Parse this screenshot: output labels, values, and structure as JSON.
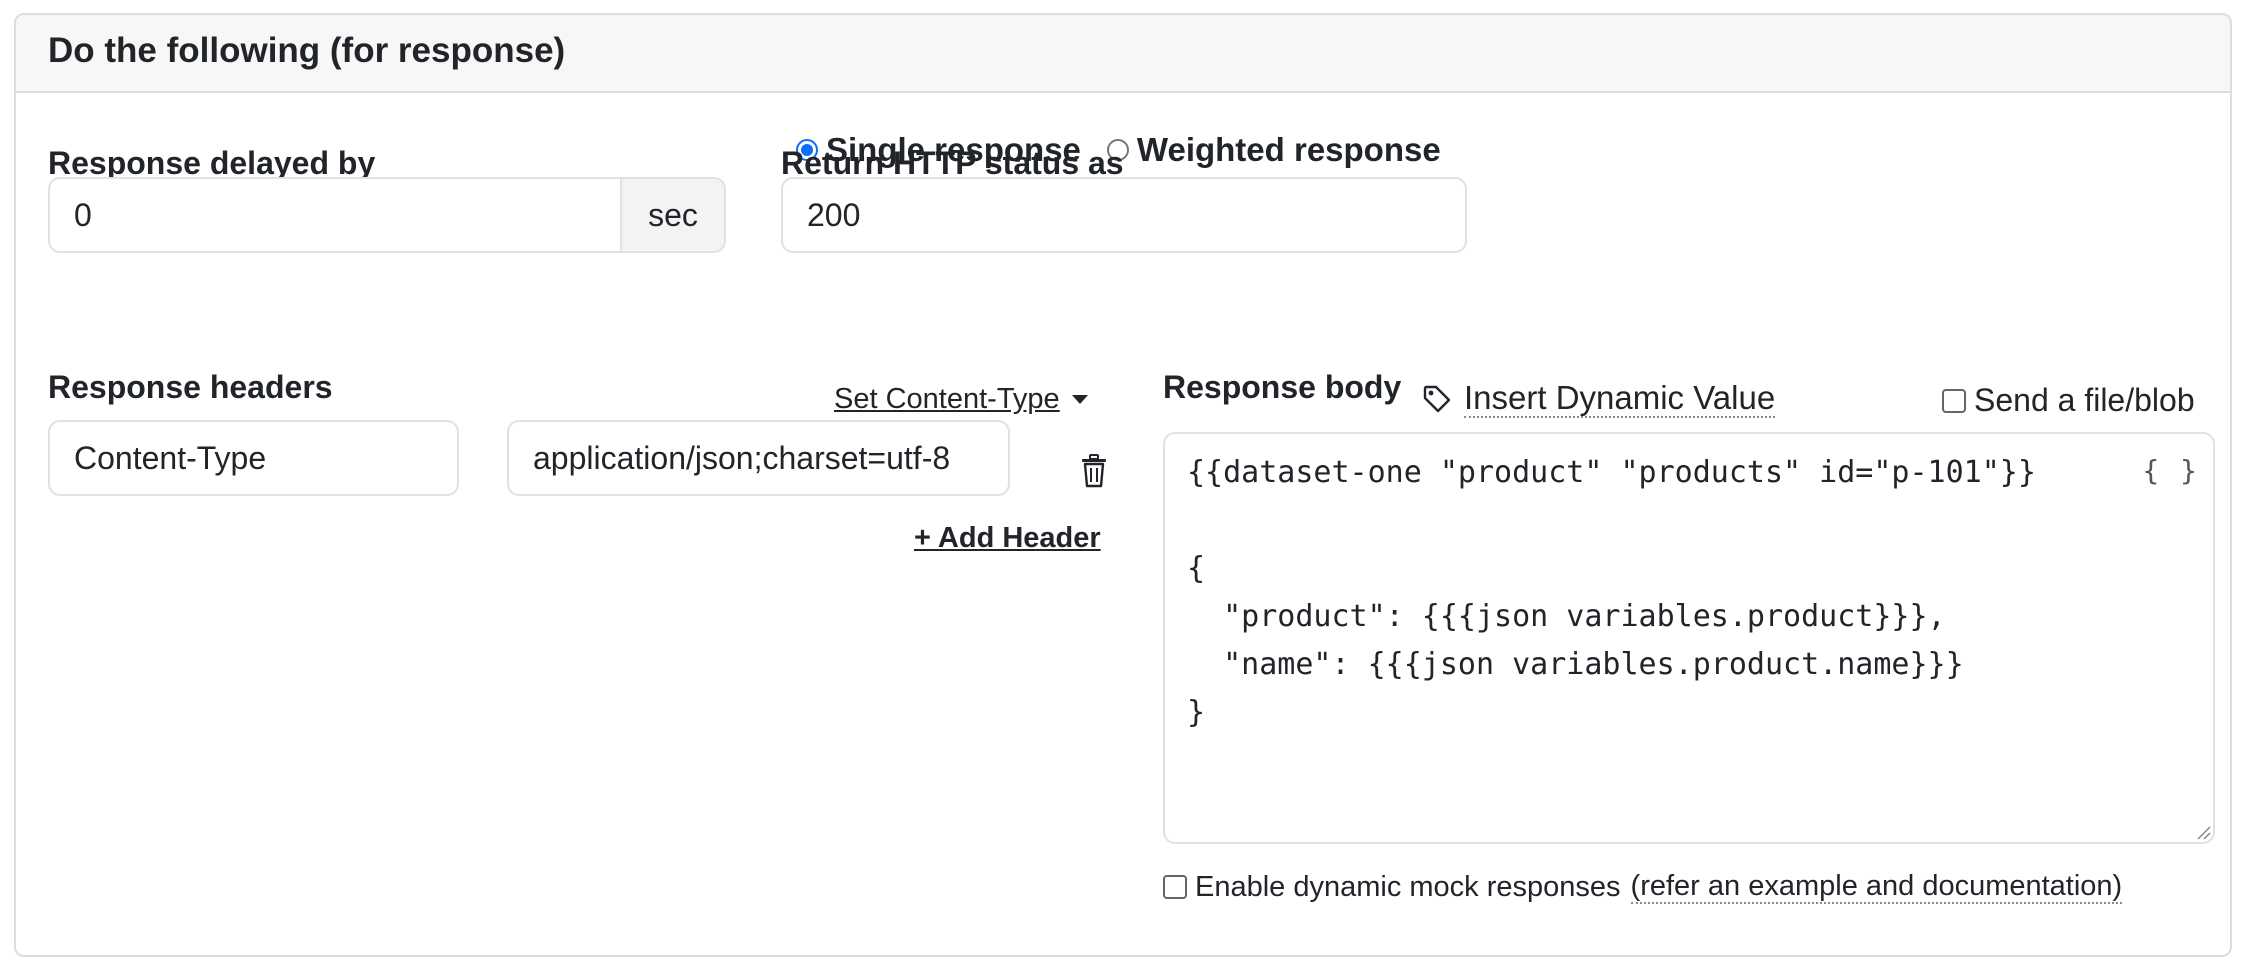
{
  "panel": {
    "title": "Do the following (for response)"
  },
  "response_mode": {
    "options": [
      {
        "label": "Single response",
        "checked": true
      },
      {
        "label": "Weighted response",
        "checked": false
      }
    ]
  },
  "delay": {
    "label": "Response delayed by",
    "value": "0",
    "unit": "sec"
  },
  "status": {
    "label": "Return HTTP status as",
    "value": "200"
  },
  "headers": {
    "label": "Response headers",
    "set_content_type": "Set Content-Type",
    "rows": [
      {
        "name": "Content-Type",
        "value": "application/json;charset=utf-8"
      }
    ],
    "add_label": "+ Add Header"
  },
  "body": {
    "label": "Response body",
    "insert_dynamic": "Insert Dynamic Value",
    "send_file_label": "Send a file/blob",
    "content": "{{dataset-one \"product\" \"products\" id=\"p-101\"}}\n\n{\n  \"product\": {{{json variables.product}}},\n  \"name\": {{{json variables.product.name}}}\n}",
    "format_icon": "{ }"
  },
  "dynamic_mock": {
    "label": "Enable dynamic mock responses",
    "link": "(refer an example and documentation)"
  },
  "icons": {
    "trash": "trash-icon",
    "tag": "tag-icon",
    "caret": "caret-down-icon"
  },
  "colors": {
    "accent": "#0d6efd",
    "border": "#dee2e6",
    "header_bg": "#f7f7f7"
  }
}
